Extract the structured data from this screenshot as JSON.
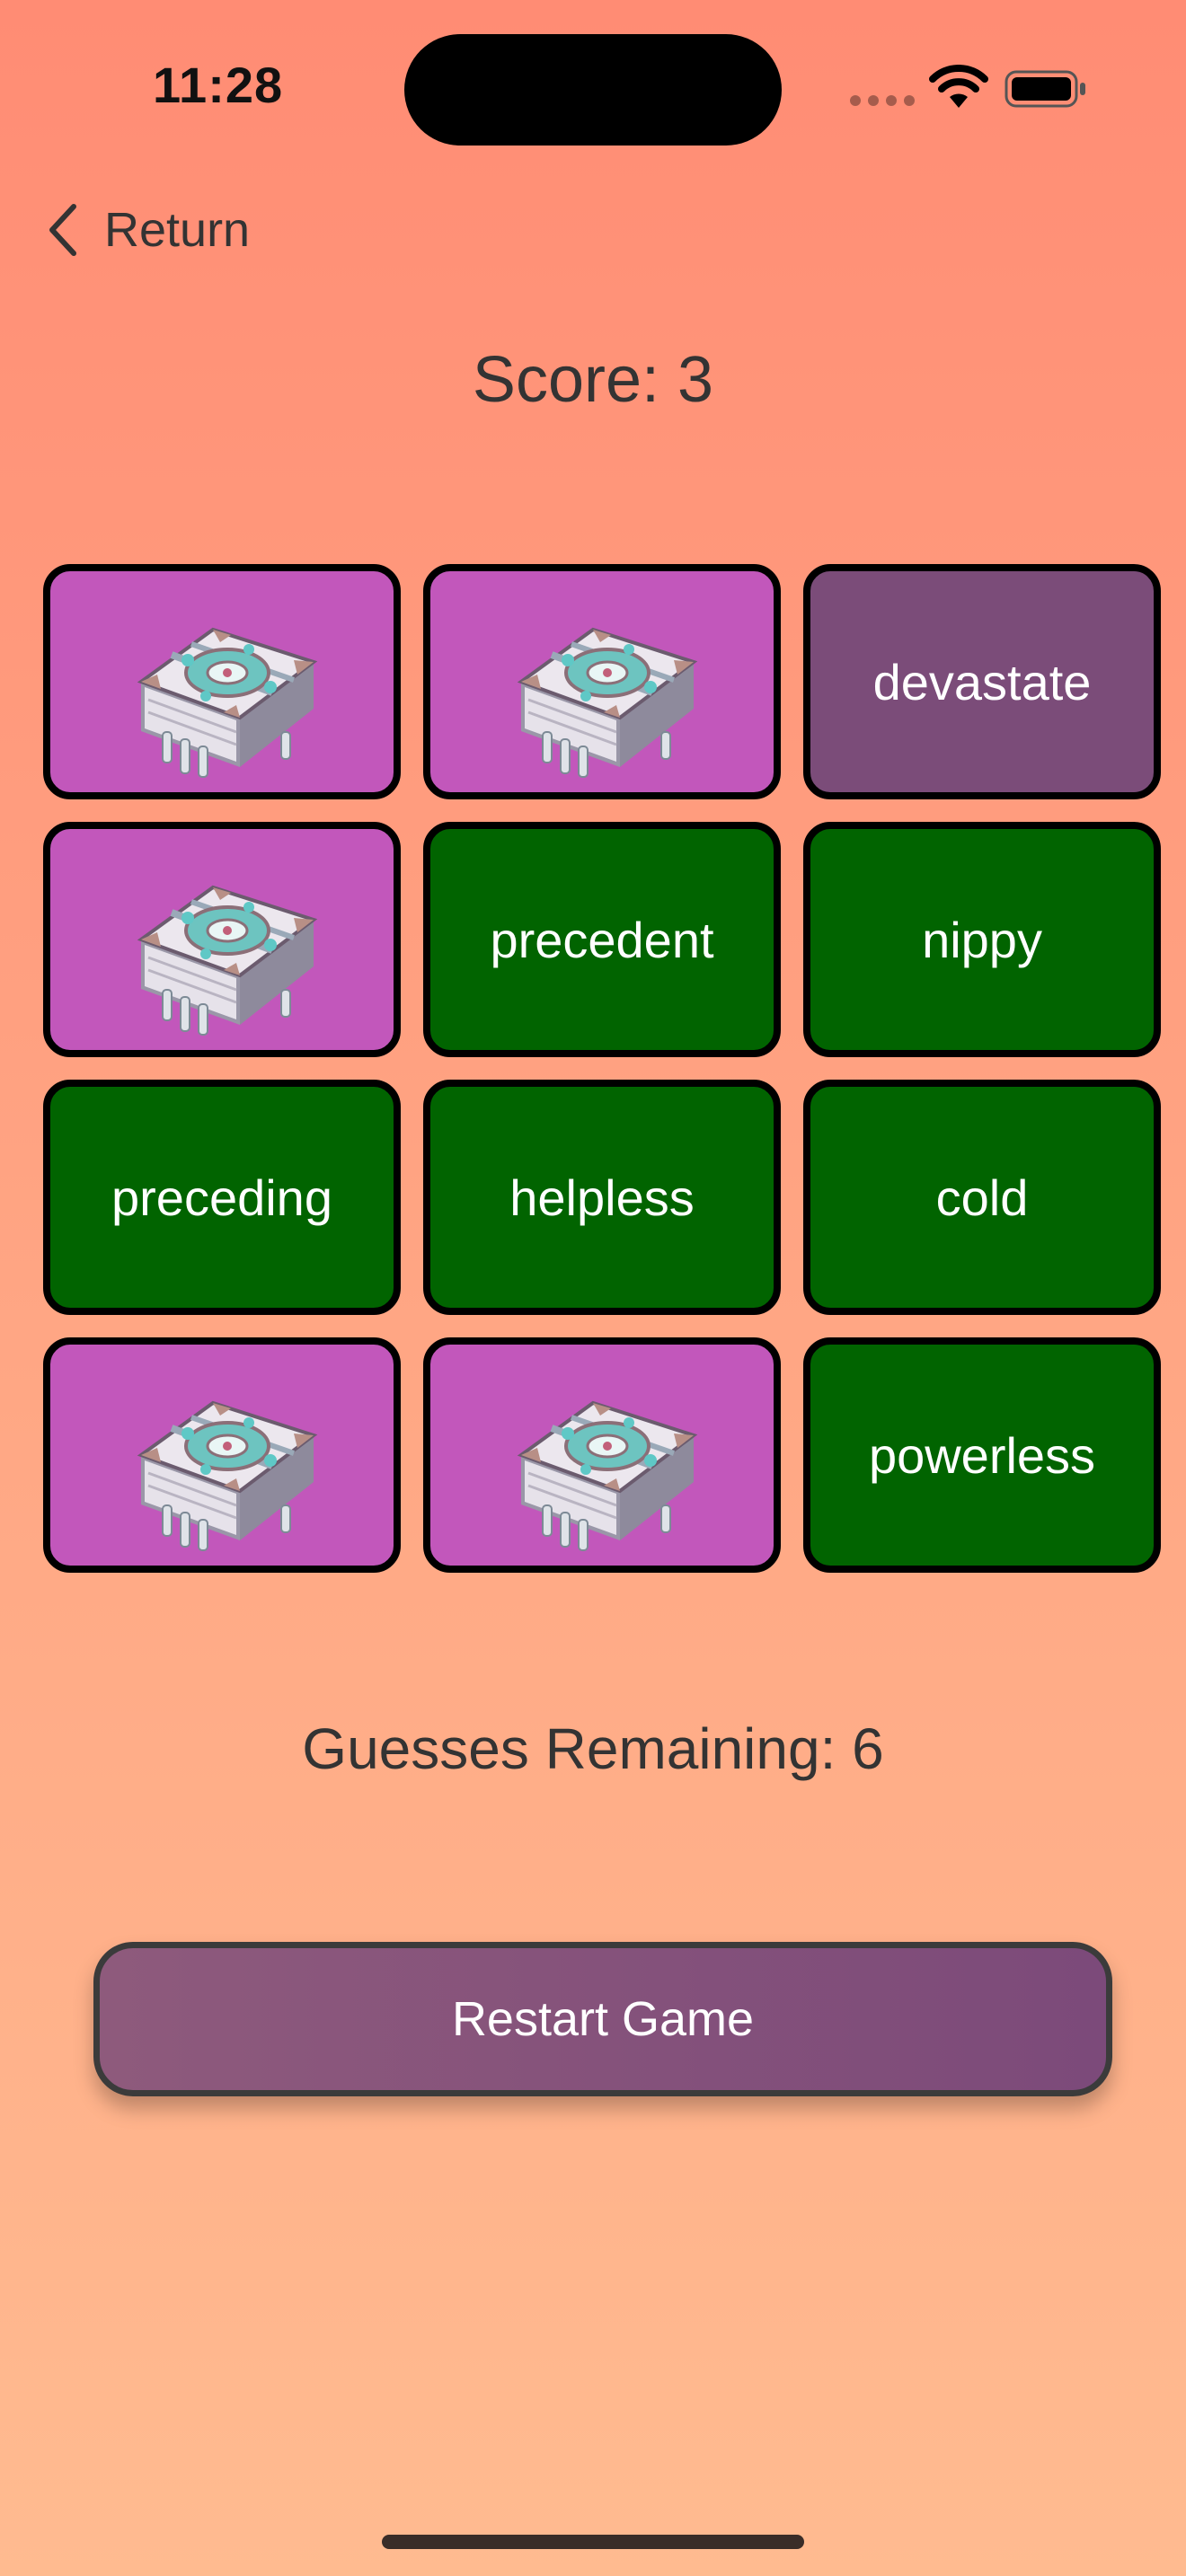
{
  "status_bar": {
    "time": "11:28"
  },
  "nav": {
    "back_label": "Return",
    "back_icon": "chevron-left-icon"
  },
  "score": {
    "label": "Score:",
    "value": "3"
  },
  "cards": [
    {
      "state": "face-down",
      "word": ""
    },
    {
      "state": "face-down",
      "word": ""
    },
    {
      "state": "selected",
      "word": "devastate"
    },
    {
      "state": "face-down",
      "word": ""
    },
    {
      "state": "matched",
      "word": "precedent"
    },
    {
      "state": "matched",
      "word": "nippy"
    },
    {
      "state": "matched",
      "word": "preceding"
    },
    {
      "state": "matched",
      "word": "helpless"
    },
    {
      "state": "matched",
      "word": "cold"
    },
    {
      "state": "face-down",
      "word": ""
    },
    {
      "state": "face-down",
      "word": ""
    },
    {
      "state": "matched",
      "word": "powerless"
    }
  ],
  "guesses": {
    "label": "Guesses Remaining:",
    "value": "6"
  },
  "restart": {
    "label": "Restart Game"
  },
  "colors": {
    "face_down": "#c257bb",
    "selected": "#7b4c79",
    "matched": "#016400",
    "background_top": "#ff8c74",
    "background_bottom": "#ffbb90"
  }
}
